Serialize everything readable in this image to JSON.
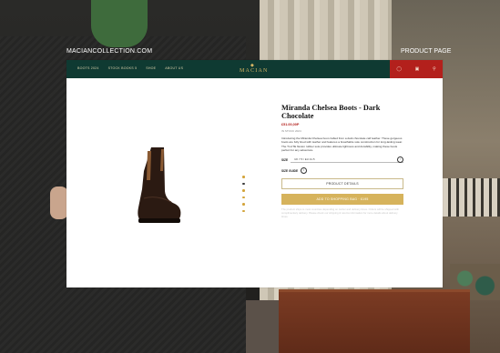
{
  "overlay": {
    "site": "MACIANCOLLECTION.COM",
    "section": "PRODUCT PAGE"
  },
  "navbar": {
    "links": [
      "BOOTS 2024",
      "STOCK BOOKS 5",
      "SHOE",
      "ABOUT US"
    ],
    "logo": "MACIAN"
  },
  "product": {
    "title": "Miranda Chelsea Boots - Dark Chocolate",
    "price": "£51.00,00P",
    "availability": "IN STOCK 2024",
    "description": "Introducing the Miranda Chelsea boot crafted from a dark chocolate calf leather. These gorgeous boots are fully lined with leather and features a breathable sole construction for long-lasting wear. The Ti-LITE flexion rubber sole provides ultimate lightness and durability, making these boots perfect for any adventure.",
    "size_label": "SIZE",
    "size_value": "UK 7.5 / EU 41.5",
    "size_guide_label": "SIZE GUIDE",
    "details_button": "PRODUCT DETAILS",
    "add_to_bag_button": "ADD TO SHOPPING BAG · £195",
    "fine_print": "The product ships to most countries depending on carrier and delivery times. Orders will be shipped with complimentary delivery. Please check our shipping & returns information for more details about delivery times."
  },
  "gallery": {
    "dot_count": 6,
    "active_index": 1
  },
  "colors": {
    "nav_green": "#0f3a32",
    "accent_red": "#b3201c",
    "gold": "#d6b35c",
    "logo_gold": "#d8b765"
  }
}
